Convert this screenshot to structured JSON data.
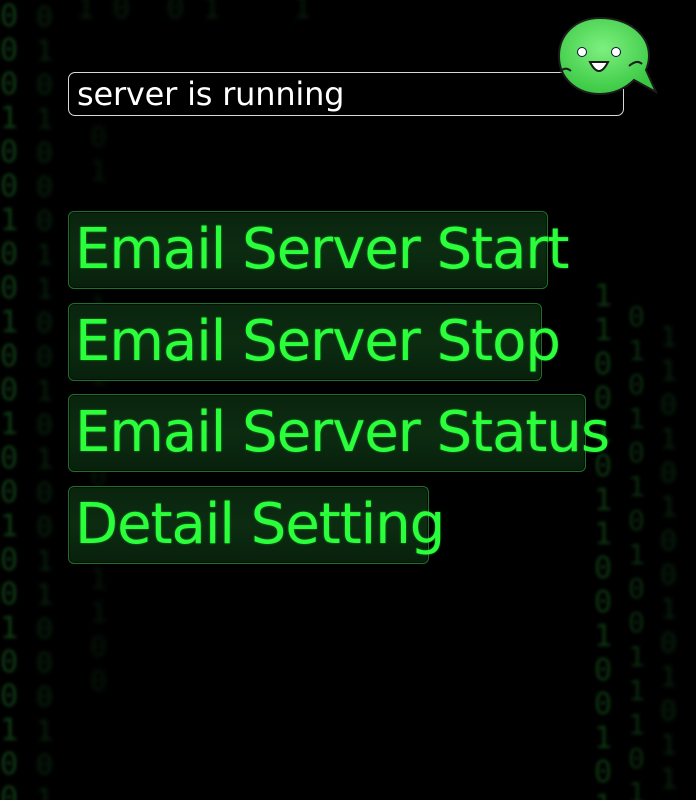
{
  "status": {
    "text": "server is running"
  },
  "mascot": {
    "icon": "chat-bubble-face-icon",
    "color": "#3ddc47"
  },
  "menu": {
    "items": [
      {
        "label": "Email Server Start"
      },
      {
        "label": "Email Server Stop"
      },
      {
        "label": "Email Server Status"
      },
      {
        "label": "Detail Setting"
      }
    ]
  },
  "theme": {
    "background": "#000000",
    "accent": "#2bff3c",
    "button_bg": "#0b2a10",
    "button_border": "#1f6f2a"
  }
}
